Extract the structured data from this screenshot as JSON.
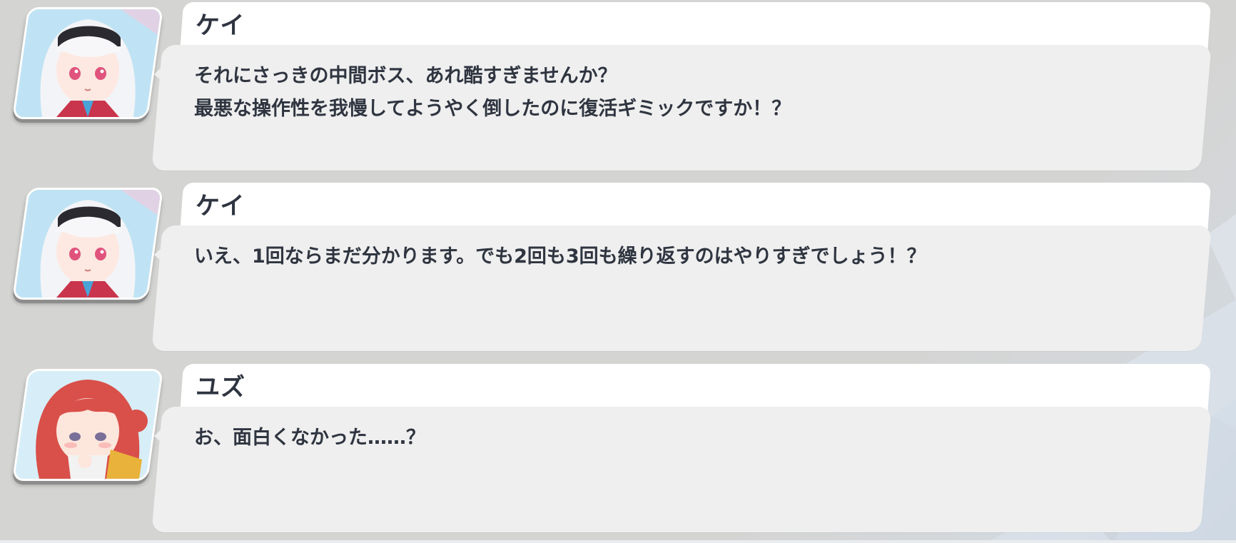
{
  "messages": [
    {
      "speaker": "ケイ",
      "avatar": "kei-portrait",
      "lines": [
        "それにさっきの中間ボス、あれ酷すぎませんか？",
        "最悪な操作性を我慢してようやく倒したのに復活ギミックですか！？"
      ]
    },
    {
      "speaker": "ケイ",
      "avatar": "kei-portrait",
      "lines": [
        "いえ、1回ならまだ分かります。でも2回も3回も繰り返すのはやりすぎでしょう！？"
      ]
    },
    {
      "speaker": "ユズ",
      "avatar": "yuzu-portrait",
      "lines": [
        "お、面白くなかった……？"
      ]
    }
  ],
  "colors": {
    "background": "#d4d4d2",
    "name_plate": "#ffffff",
    "bubble": "#efefef",
    "text": "#2f3540"
  }
}
